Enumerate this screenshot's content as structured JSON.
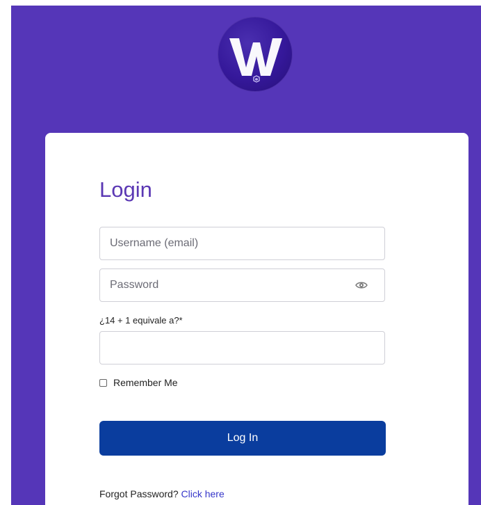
{
  "logo": {
    "icon": "w-logo-icon",
    "letter": "W"
  },
  "login": {
    "title": "Login",
    "username_placeholder": "Username (email)",
    "password_placeholder": "Password",
    "captcha_label": "¿14 + 1 equivale a?*",
    "remember_label": "Remember Me",
    "button_label": "Log In",
    "forgot_text": "Forgot Password?",
    "forgot_link": "Click here"
  },
  "colors": {
    "background": "#5536b8",
    "title": "#5b38b4",
    "button": "#0a3d9e",
    "link": "#3536c9"
  },
  "icons": {
    "password_toggle": "eye-icon"
  }
}
